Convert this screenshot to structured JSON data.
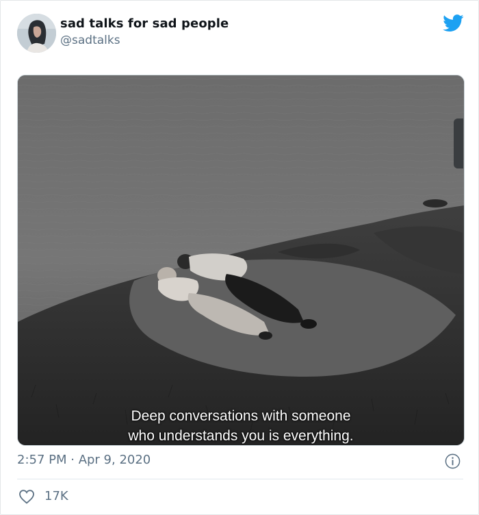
{
  "tweet": {
    "author": {
      "display_name": "sad talks for sad people",
      "handle": "@sadtalks"
    },
    "media": {
      "caption_lines": [
        "Deep conversations with someone",
        "who understands you is everything."
      ]
    },
    "timestamp": "2:57 PM · Apr 9, 2020",
    "likes": "17K"
  },
  "colors": {
    "brand_blue": "#1da1f2",
    "secondary_text": "#5b7083",
    "divider": "#e1e8ed"
  },
  "icons": {
    "brand": "twitter-bird-icon",
    "info": "info-icon",
    "like": "heart-outline-icon"
  }
}
